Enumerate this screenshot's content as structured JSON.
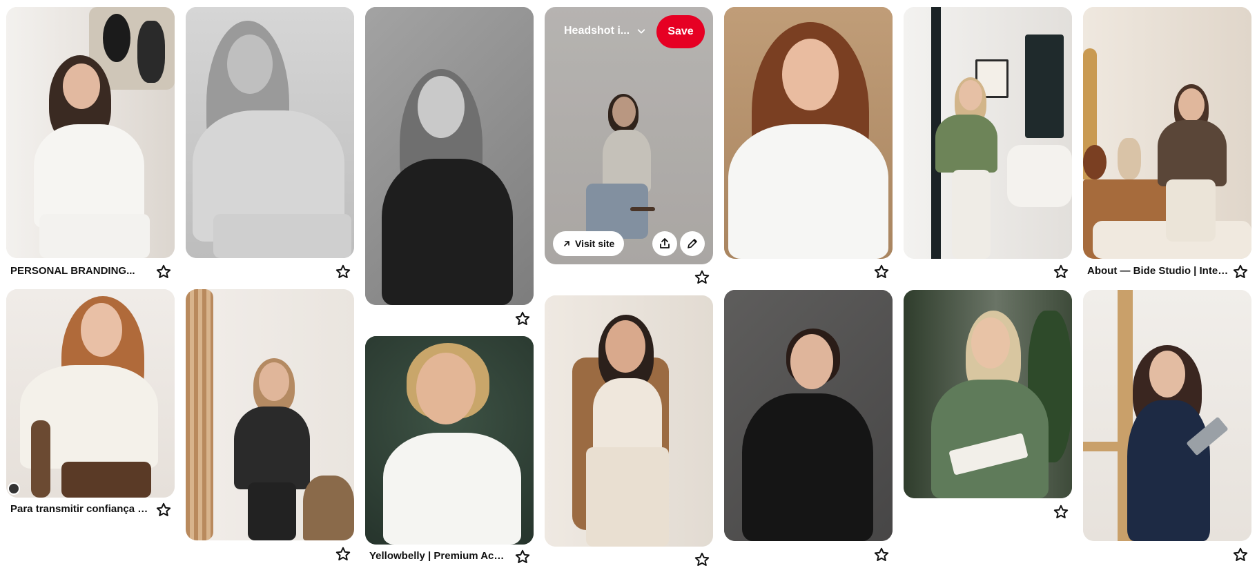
{
  "pins": [
    {
      "id": "c1r1",
      "caption": "PERSONAL BRANDING...",
      "bg": "#e8e4e0",
      "person": {
        "hair": "#3a2a22",
        "top": "#f6f5f2",
        "legs": "#f3f2ef",
        "skin": "#e2b9a0"
      }
    },
    {
      "id": "c1r2",
      "caption": "Para transmitir confiança e...",
      "bg": "#ebe7e3",
      "person": {
        "hair": "#b06a3a",
        "top": "#f4f1ea",
        "legs": "#5a3a26",
        "skin": "#e9c0a6"
      }
    },
    {
      "id": "c2r1",
      "caption": "",
      "bg": "#c9c9c9",
      "person": {
        "hair": "#9a9a9a",
        "top": "#d6d6d6",
        "legs": "#cfcfcf",
        "skin": "#bfbfbf"
      }
    },
    {
      "id": "c2r2",
      "caption": "",
      "bg": "#eeeae6",
      "person": {
        "hair": "#b48a62",
        "top": "#2a2a2a",
        "legs": "#222222",
        "skin": "#e0b69a"
      }
    },
    {
      "id": "c3r1",
      "caption": "",
      "bg": "#8f8f8f",
      "person": {
        "hair": "#6f6f6f",
        "top": "#1e1e1e",
        "legs": "#1e1e1e",
        "skin": "#c9c9c9"
      }
    },
    {
      "id": "c3r2",
      "caption": "Yellowbelly | Premium Actor...",
      "bg": "#2f4036",
      "person": {
        "hair": "#c9a66a",
        "top": "#f5f5f2",
        "legs": "#e9e9e6",
        "skin": "#e3b696"
      }
    },
    {
      "id": "c4r1",
      "caption": "",
      "bg": "#d9d6d3",
      "person": {
        "hair": "#3b2b22",
        "top": "#f1ece2",
        "legs": "#9fb0c4",
        "skin": "#e2b99e"
      }
    },
    {
      "id": "c4r2",
      "caption": "",
      "bg": "#e8e3dc",
      "person": {
        "hair": "#2b201b",
        "top": "#efe7dc",
        "legs": "#e9dfd1",
        "skin": "#d9a98c"
      }
    },
    {
      "id": "c5r1",
      "caption": "",
      "bg": "#b7946e",
      "person": {
        "hair": "#7a3f22",
        "top": "#f6f6f4",
        "legs": "#f2f2f0",
        "skin": "#e9bca0"
      }
    },
    {
      "id": "c5r2",
      "caption": "",
      "bg": "#545353",
      "person": {
        "hair": "#2a1c17",
        "top": "#151515",
        "legs": "#151515",
        "skin": "#dfb59b"
      }
    },
    {
      "id": "c6r1",
      "caption": "",
      "bg": "#e7e5e2",
      "person": {
        "hair": "#d2b58a",
        "top": "#6d8458",
        "legs": "#efece6",
        "skin": "#e6c0a5"
      }
    },
    {
      "id": "c6r2",
      "caption": "",
      "bg": "#4a5a44",
      "person": {
        "hair": "#d8c6a0",
        "top": "#5f7b5a",
        "legs": "#5f7b5a",
        "skin": "#e8c3a6"
      }
    },
    {
      "id": "c7r1",
      "caption": "About — Bide Studio | Interio...",
      "bg": "#e5ddd2",
      "person": {
        "hair": "#4a3226",
        "top": "#5a4638",
        "legs": "#ebe4d8",
        "skin": "#e0b79c"
      }
    },
    {
      "id": "c7r2",
      "caption": "",
      "bg": "#ede9e4",
      "person": {
        "hair": "#3a2620",
        "top": "#1d2a44",
        "legs": "#1d2a44",
        "skin": "#e3bca2"
      }
    }
  ],
  "hover_pin": {
    "board_label": "Headshot i...",
    "save_label": "Save",
    "visit_label": "Visit site",
    "icons": [
      "arrow-up-right-icon",
      "share-icon",
      "edit-pencil-icon",
      "chevron-down-icon"
    ]
  },
  "colors": {
    "save": "#e60023",
    "text": "#111111"
  }
}
